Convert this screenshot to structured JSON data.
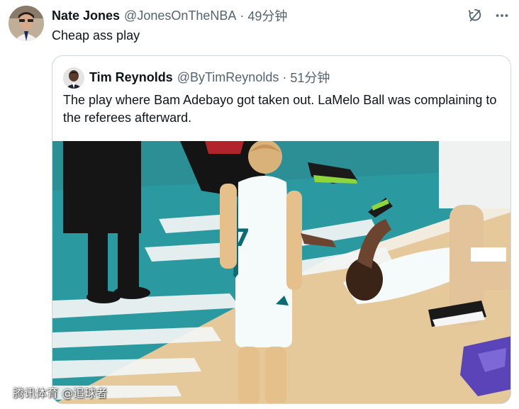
{
  "tweet": {
    "author_name": "Nate Jones",
    "author_handle": "@JonesOnTheNBA",
    "separator": "·",
    "time": "49分钟",
    "text": "Cheap ass play",
    "action_icons": [
      "mute-conversation-icon",
      "more-options-icon"
    ]
  },
  "quoted_tweet": {
    "author_name": "Tim Reynolds",
    "author_handle": "@ByTimReynolds",
    "separator": "·",
    "time": "51分钟",
    "text": "The play where Bam Adebayo got taken out. LaMelo Ball was complaining to the referees afterward.",
    "jersey_number": "7"
  },
  "watermark": "腾讯体育 @追球者",
  "colors": {
    "court_teal": "#2a9aa0",
    "court_wood": "#e6c99a",
    "text_primary": "#0f1419",
    "text_secondary": "#536471",
    "border": "#cfd9de"
  }
}
